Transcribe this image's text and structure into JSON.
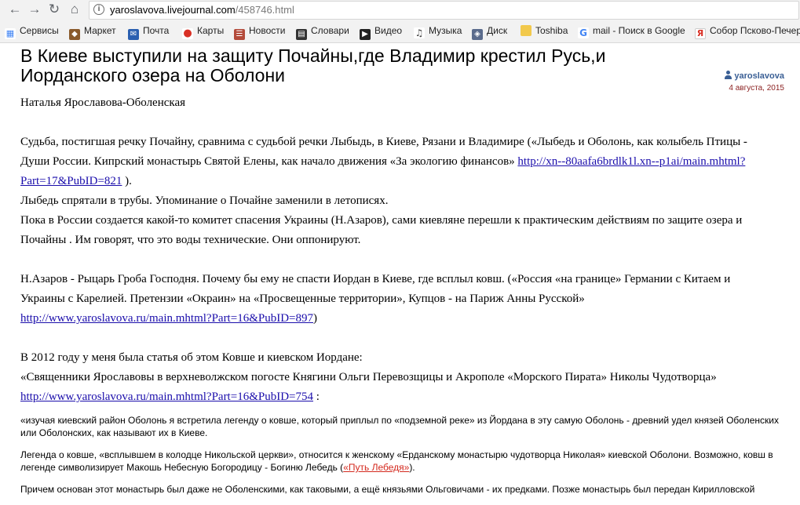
{
  "browser": {
    "url_host": "yaroslavova.livejournal.com",
    "url_path": "/458746.html",
    "bookmarks": [
      {
        "label": "Сервисы",
        "icon": "apps-grid-icon",
        "color": "#4285f4"
      },
      {
        "label": "Маркет",
        "icon": "market-icon",
        "color": "#8a5a2b"
      },
      {
        "label": "Почта",
        "icon": "mail-icon",
        "color": "#2a5fb0"
      },
      {
        "label": "Карты",
        "icon": "map-pin-icon",
        "color": "#d93025"
      },
      {
        "label": "Новости",
        "icon": "news-icon",
        "color": "#b34a3a"
      },
      {
        "label": "Словари",
        "icon": "dictionary-icon",
        "color": "#333333"
      },
      {
        "label": "Видео",
        "icon": "video-play-icon",
        "color": "#222222"
      },
      {
        "label": "Музыка",
        "icon": "music-icon",
        "color": "#444444"
      },
      {
        "label": "Диск",
        "icon": "disk-icon",
        "color": "#5a6b8c"
      },
      {
        "label": "Toshiba",
        "icon": "folder-icon",
        "color": "#f2c94c"
      },
      {
        "label": "mail - Поиск в Google",
        "icon": "google-icon",
        "color": "#4285f4"
      },
      {
        "label": "Собор Псково-Печер",
        "icon": "yandex-icon",
        "color": "#d93025"
      }
    ]
  },
  "post": {
    "title": "В Киеве выступили на защиту Почайны,где Владимир крестил Русь,и Иорданского озера на Оболони",
    "username": "yaroslavova",
    "date": "4 августа, 2015",
    "byline": "Наталья  Ярославова-Оболенская",
    "p1_text": "Судьба, постигшая речку   Почайну,  сравнима с  судьбой речки  Лыбыдь, в  Киеве, Рязани и Владимире («Лыбедь и Оболонь, как колыбель Птицы - Души России. Кипрский монастырь Святой Елены, как начало движения «За экологию финансов» ",
    "p1_link": "http://xn--80aafa6brdlk1l.xn--p1ai/main.mhtml?Part=17&PubID=821",
    "p1_tail": " ).",
    "p2": "Лыбедь спрятали в   трубы. Упоминание  о Почайне  заменили  в  летописях.",
    "p3": "Пока в России создается  какой-то  комитет спасения  Украины (Н.Азаров),  сами  киевляне  перешли к практическим  действиям по  защите озера и Почайны  .   Им говорят, что это   воды    технические.  Они   оппонируют.",
    "p4_text": "Н.Азаров   - Рыцарь  Гроба    Господня. Почему  бы ему не спасти Иордан в  Киеве,  где всплыл  ковш.  («Россия «на границе» Германии с Китаем и Украины с Карелией. Претензии «Окраин» на «Просвещенные территории», Купцов - на Париж Анны Русской» ",
    "p4_link": "http://www.yaroslavova.ru/main.mhtml?Part=16&PubID=897",
    "p4_tail": ")",
    "p5": "В 2012 году     у меня  была  статья  об   этом  Ковше и  киевском Иордане:",
    "p6": "«Священники Ярославовы в верхневолжском погосте Княгини Ольги Перевозщицы и Акрополе «Морского Пирата» Николы Чудотворца»",
    "p7_link": "http://www.yaroslavova.ru/main.mhtml?Part=16&PubID=754",
    "p7_tail": " :",
    "q1": "«изучая киевский район Оболонь я встретила легенду о ковше, который приплыл по «подземной реке» из Йордана в эту самую Оболонь - древний удел князей Оболенских или Оболонских, как называют их в Киеве.",
    "q2_text": "Легенда о ковше, «всплывшем в колодце Никольской церкви», относится к женскому «Ерданскому монастырю чудотворца Николая» киевской Оболони. Возможно, ковш в легенде символизирует Макошь Небесную Богородицу - Богиню Лебедь (",
    "q2_link": "«Путь Лебедя»",
    "q2_tail": ").",
    "q3": "Причем основан этот монастырь был даже не Оболенскими, как таковыми, а ещё князьями Ольговичами - их предками. Позже монастырь был передан Кирилловской"
  }
}
